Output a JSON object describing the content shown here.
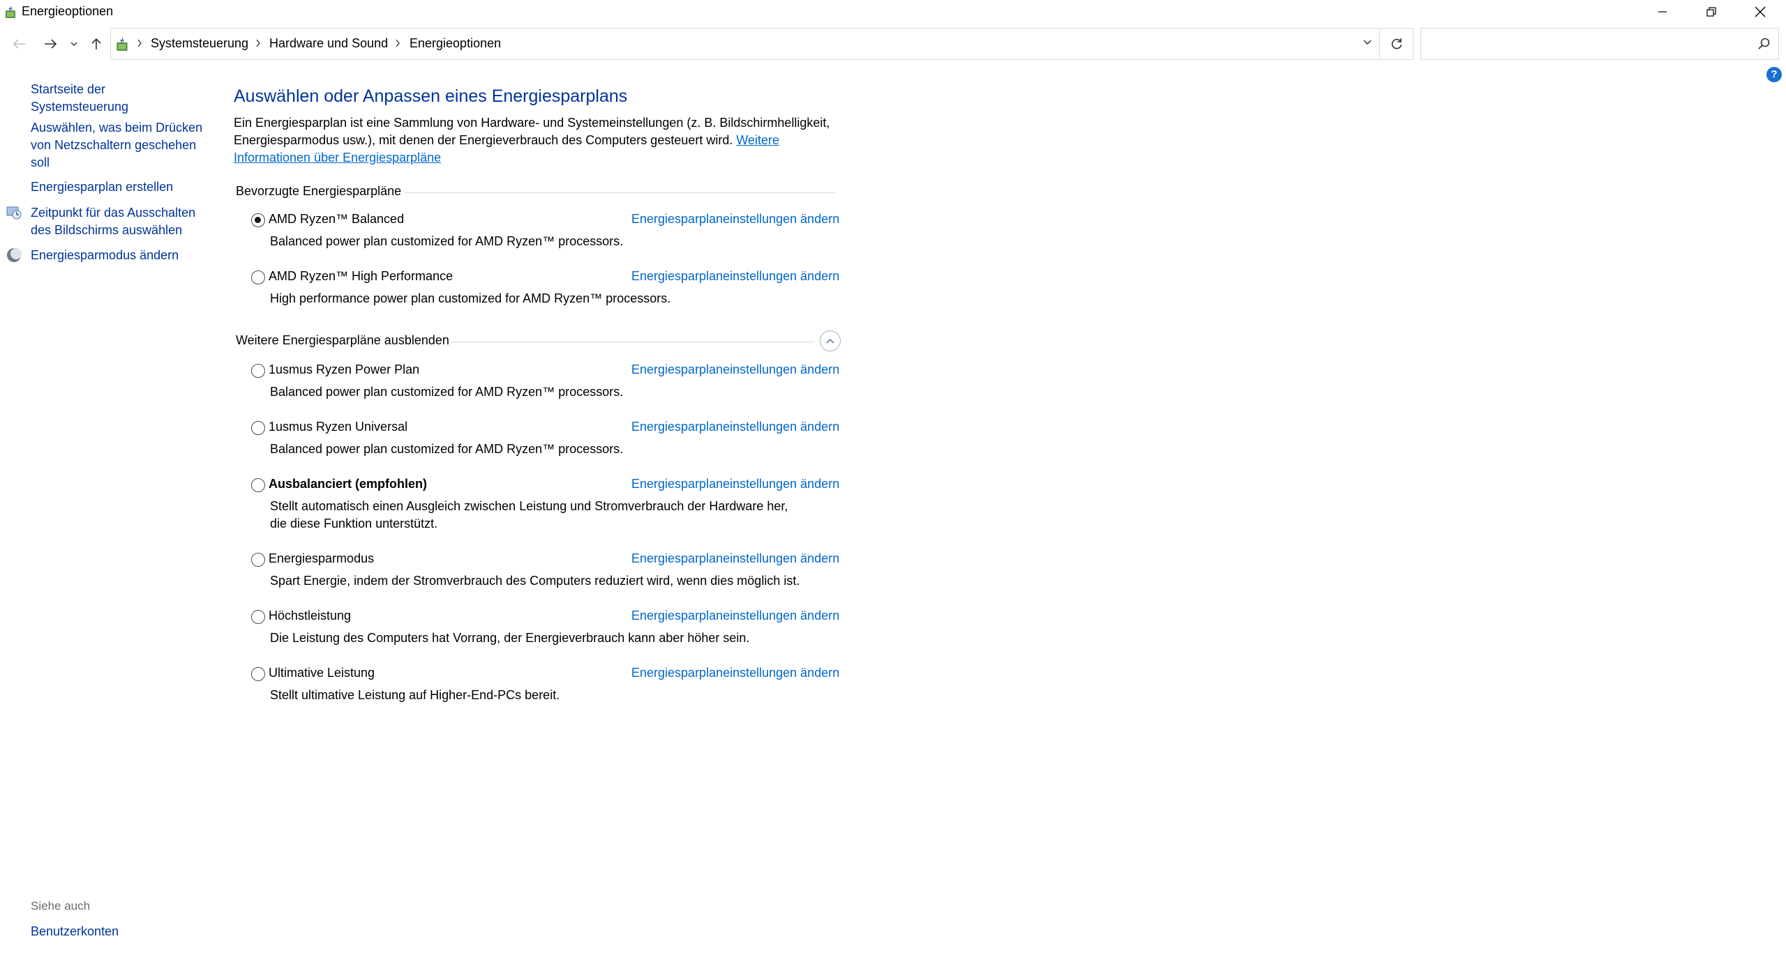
{
  "window": {
    "title": "Energieoptionen"
  },
  "breadcrumb": {
    "items": [
      "Systemsteuerung",
      "Hardware und Sound",
      "Energieoptionen"
    ]
  },
  "search": {
    "value": "",
    "placeholder": ""
  },
  "help": {
    "label": "?"
  },
  "sidebar": {
    "items": [
      {
        "label": "Startseite der Systemsteuerung"
      },
      {
        "label": "Auswählen, was beim Drücken von Netzschaltern geschehen soll"
      },
      {
        "label": "Energiesparplan erstellen"
      },
      {
        "label": "Zeitpunkt für das Ausschalten des Bildschirms auswählen"
      },
      {
        "label": "Energiesparmodus ändern"
      }
    ],
    "see_also_label": "Siehe auch",
    "see_also_items": [
      {
        "label": "Benutzerkonten"
      }
    ]
  },
  "main": {
    "title": "Auswählen oder Anpassen eines Energiesparplans",
    "intro_text": "Ein Energiesparplan ist eine Sammlung von Hardware- und Systemeinstellungen (z. B. Bildschirmhelligkeit, Energiesparmodus usw.), mit denen der Energieverbrauch des Computers gesteuert wird. ",
    "intro_link": "Weitere Informationen über Energiesparpläne",
    "preferred_header": "Bevorzugte Energiesparpläne",
    "more_header": "Weitere Energiesparpläne ausblenden",
    "change_link": "Energiesparplaneinstellungen ändern",
    "preferred_plans": [
      {
        "name": "AMD Ryzen™ Balanced",
        "desc": "Balanced power plan customized for AMD Ryzen™ processors.",
        "selected": true
      },
      {
        "name": "AMD Ryzen™ High Performance",
        "desc": "High performance power plan customized for AMD Ryzen™ processors.",
        "selected": false
      }
    ],
    "more_plans": [
      {
        "name": "1usmus Ryzen Power Plan",
        "desc": "Balanced power plan customized for AMD Ryzen™ processors.",
        "selected": false
      },
      {
        "name": "1usmus Ryzen Universal",
        "desc": "Balanced power plan customized for AMD Ryzen™ processors.",
        "selected": false
      },
      {
        "name": "Ausbalanciert (empfohlen)",
        "desc": "Stellt automatisch einen Ausgleich zwischen Leistung und Stromverbrauch der Hardware her, die diese Funktion unterstützt.",
        "selected": false
      },
      {
        "name": "Energiesparmodus",
        "desc": "Spart Energie, indem der Stromverbrauch des Computers reduziert wird, wenn dies möglich ist.",
        "selected": false
      },
      {
        "name": "Höchstleistung",
        "desc": "Die Leistung des Computers hat Vorrang, der Energieverbrauch kann aber höher sein.",
        "selected": false
      },
      {
        "name": "Ultimative Leistung",
        "desc": "Stellt ultimative Leistung auf Higher-End-PCs bereit.",
        "selected": false
      }
    ]
  },
  "colors": {
    "link": "#0066cc",
    "nav_link": "#003399",
    "title": "#003399"
  }
}
